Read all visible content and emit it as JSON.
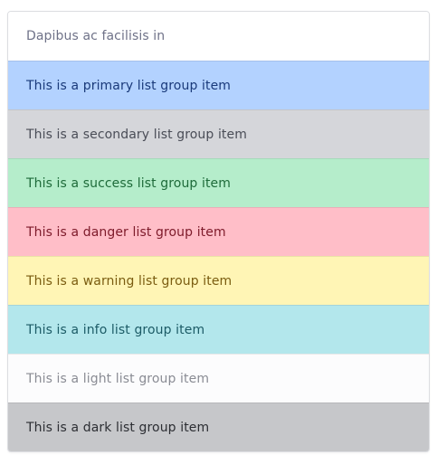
{
  "list_group": {
    "items": [
      {
        "label": "Dapibus ac facilisis in",
        "variant": "default",
        "bg": "#ffffff",
        "color": "#6f7288"
      },
      {
        "label": "This is a primary list group item",
        "variant": "primary",
        "bg": "#b3d2ff",
        "color": "#1a3a7a"
      },
      {
        "label": "This is a secondary list group item",
        "variant": "secondary",
        "bg": "#d5d6da",
        "color": "#4a4d57"
      },
      {
        "label": "This is a success list group item",
        "variant": "success",
        "bg": "#b5edcb",
        "color": "#1e6b3a"
      },
      {
        "label": "This is a danger list group item",
        "variant": "danger",
        "bg": "#ffbec8",
        "color": "#7d1a2a"
      },
      {
        "label": "This is a warning list group item",
        "variant": "warning",
        "bg": "#fff5b5",
        "color": "#7a5c10"
      },
      {
        "label": "This is a info list group item",
        "variant": "info",
        "bg": "#b3e7ec",
        "color": "#1c5b66"
      },
      {
        "label": "This is a light list group item",
        "variant": "light",
        "bg": "#fcfcfd",
        "color": "#8a8c94"
      },
      {
        "label": "This is a dark list group item",
        "variant": "dark",
        "bg": "#c6c7ca",
        "color": "#2c2e33"
      }
    ]
  }
}
